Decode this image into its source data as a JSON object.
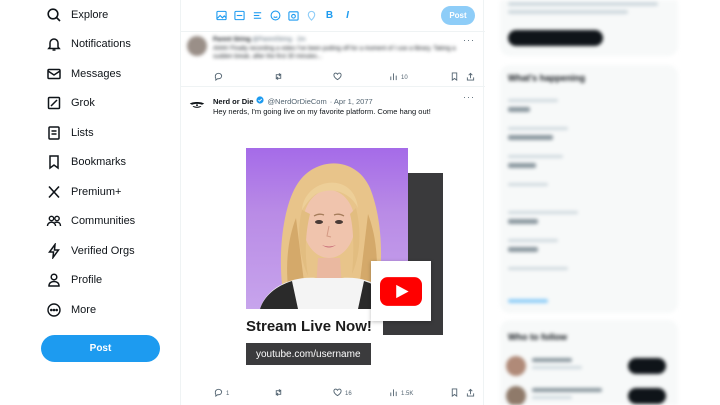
{
  "sidebar": {
    "items": [
      {
        "label": "Explore",
        "icon": "search-icon"
      },
      {
        "label": "Notifications",
        "icon": "bell-icon"
      },
      {
        "label": "Messages",
        "icon": "envelope-icon"
      },
      {
        "label": "Grok",
        "icon": "grok-icon"
      },
      {
        "label": "Lists",
        "icon": "list-icon"
      },
      {
        "label": "Bookmarks",
        "icon": "bookmark-icon"
      },
      {
        "label": "Premium+",
        "icon": "x-logo-icon"
      },
      {
        "label": "Communities",
        "icon": "people-icon"
      },
      {
        "label": "Verified Orgs",
        "icon": "lightning-icon"
      },
      {
        "label": "Profile",
        "icon": "person-icon"
      },
      {
        "label": "More",
        "icon": "more-circle-icon"
      }
    ],
    "post_label": "Post"
  },
  "composer": {
    "post_label": "Post",
    "tools": [
      "image-icon",
      "gif-icon",
      "poll-icon",
      "emoji-icon",
      "schedule-icon",
      "location-icon",
      "bold-icon",
      "italic-icon"
    ]
  },
  "tweet1": {
    "name": "Parent String",
    "handle": "@ParentString · 2m",
    "text": "Ahhh! Finally recording a video I've been putting off for a moment of I use a library. Taking a sudden break, after the first 30 minutes...",
    "stats": {
      "replies": "",
      "reposts": "",
      "likes": "",
      "views": "10"
    }
  },
  "tweet2": {
    "name": "Nerd or Die",
    "handle": "@NerdOrDieCom",
    "date": "· Apr 1, 2077",
    "text": "Hey nerds, I'm going live on my favorite platform. Come hang out!",
    "card_title": "Stream Live Now!",
    "card_url": "youtube.com/username",
    "stats": {
      "replies": "1",
      "reposts": "",
      "likes": "16",
      "views": "1.5K"
    }
  },
  "right": {
    "top_button": "Upgrade to Premium+",
    "trends_title": "What's happening",
    "follow_title": "Who to follow",
    "follow_button": "Follow"
  },
  "colors": {
    "accent": "#1d9bf0",
    "youtube": "#ff0000",
    "text": "#0f1419",
    "muted": "#536471"
  }
}
